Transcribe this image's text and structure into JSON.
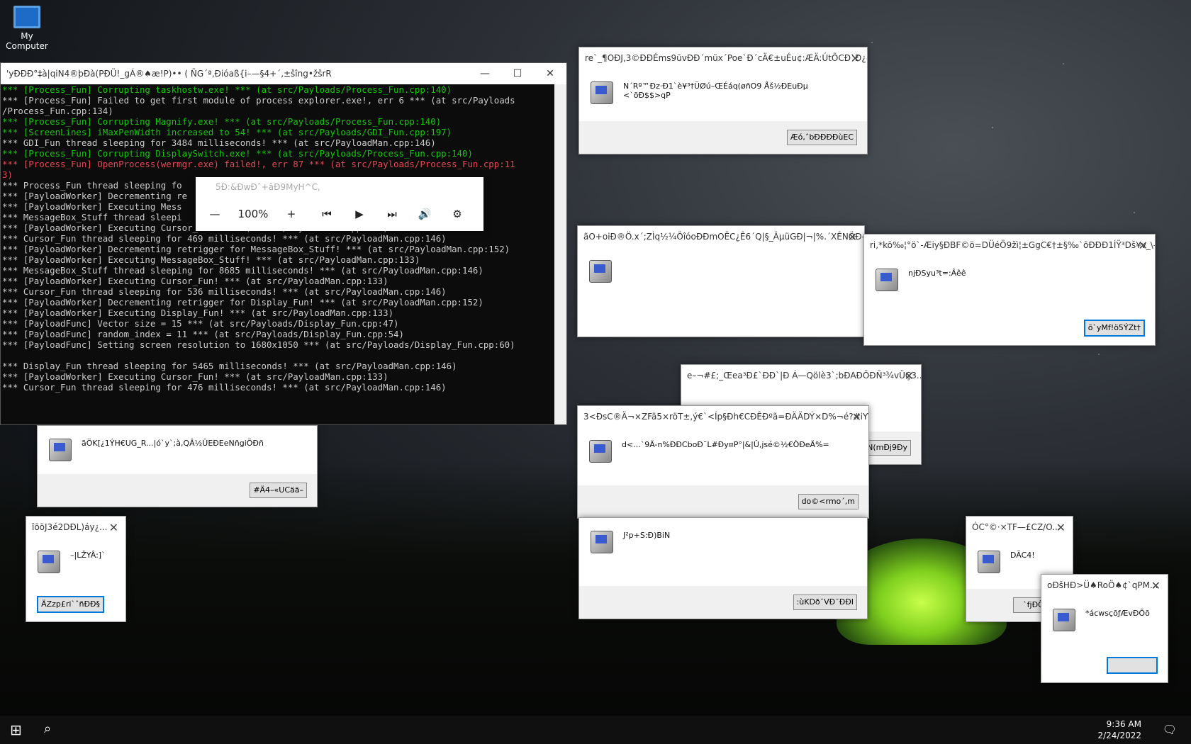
{
  "desktop": {
    "icon_label_1": "My",
    "icon_label_2": "Computer"
  },
  "console": {
    "title": "'yÐÐÐ°‡à|qiN4®þÐà(PÐÜ!_gÁ®♠æ!P)•• ( ÑG´ª,Ðióaß{i–—§4+´,±šîng•žšrR",
    "lines": [
      {
        "t": "*** [Process_Fun] Corrupting taskhostw.exe! *** (at src/Payloads/Process_Fun.cpp:140)",
        "c": "g"
      },
      {
        "t": "*** [Process_Fun] Failed to get first module of process explorer.exe!, err 6 *** (at src/Payloads",
        "c": "w"
      },
      {
        "t": "/Process_Fun.cpp:134)",
        "c": "w"
      },
      {
        "t": "*** [Process_Fun] Corrupting Magnify.exe! *** (at src/Payloads/Process_Fun.cpp:140)",
        "c": "g"
      },
      {
        "t": "*** [ScreenLines] iMaxPenWidth increased to 54! *** (at src/Payloads/GDI_Fun.cpp:197)",
        "c": "g"
      },
      {
        "t": "*** GDI_Fun thread sleeping for 3484 milliseconds! *** (at src/PayloadMan.cpp:146)",
        "c": "w"
      },
      {
        "t": "*** [Process_Fun] Corrupting DisplaySwitch.exe! *** (at src/Payloads/Process_Fun.cpp:140)",
        "c": "g"
      },
      {
        "t": "*** [Process_Fun] OpenProcess(wermgr.exe) failed!, err 87 *** (at src/Payloads/Process_Fun.cpp:11",
        "c": "r"
      },
      {
        "t": "3)",
        "c": "r"
      },
      {
        "t": "*** Process_Fun thread sleeping fo                                        an.cpp:152)",
        "c": "w"
      },
      {
        "t": "*** [PayloadWorker] Decrementing re",
        "c": "w"
      },
      {
        "t": "*** [PayloadWorker] Executing Mess",
        "c": "w"
      },
      {
        "t": "*** MessageBox_Stuff thread sleepi                                        :146)",
        "c": "w"
      },
      {
        "t": "*** [PayloadWorker] Executing Cursor_Fun! *** (at src/PayloadMan.cpp:133)",
        "c": "w"
      },
      {
        "t": "*** Cursor_Fun thread sleeping for 469 milliseconds! *** (at src/PayloadMan.cpp:146)",
        "c": "w"
      },
      {
        "t": "*** [PayloadWorker] Decrementing retrigger for MessageBox_Stuff! *** (at src/PayloadMan.cpp:152)",
        "c": "w"
      },
      {
        "t": "*** [PayloadWorker] Executing MessageBox_Stuff! *** (at src/PayloadMan.cpp:133)",
        "c": "w"
      },
      {
        "t": "*** MessageBox_Stuff thread sleeping for 8685 milliseconds! *** (at src/PayloadMan.cpp:146)",
        "c": "w"
      },
      {
        "t": "*** [PayloadWorker] Executing Cursor_Fun! *** (at src/PayloadMan.cpp:133)",
        "c": "w"
      },
      {
        "t": "*** Cursor_Fun thread sleeping for 536 milliseconds! *** (at src/PayloadMan.cpp:146)",
        "c": "w"
      },
      {
        "t": "*** [PayloadWorker] Decrementing retrigger for Display_Fun! *** (at src/PayloadMan.cpp:152)",
        "c": "w"
      },
      {
        "t": "*** [PayloadWorker] Executing Display_Fun! *** (at src/PayloadMan.cpp:133)",
        "c": "w"
      },
      {
        "t": "*** [PayloadFunc] Vector size = 15 *** (at src/Payloads/Display_Fun.cpp:47)",
        "c": "w"
      },
      {
        "t": "*** [PayloadFunc] random_index = 11 *** (at src/Payloads/Display_Fun.cpp:54)",
        "c": "w"
      },
      {
        "t": "*** [PayloadFunc] Setting screen resolution to 1680x1050 *** (at src/Payloads/Display_Fun.cpp:60)",
        "c": "w"
      },
      {
        "t": "",
        "c": "w"
      },
      {
        "t": "*** Display_Fun thread sleeping for 5465 milliseconds! *** (at src/PayloadMan.cpp:146)",
        "c": "w"
      },
      {
        "t": "*** [PayloadWorker] Executing Cursor_Fun! *** (at src/PayloadMan.cpp:133)",
        "c": "w"
      },
      {
        "t": "*** Cursor_Fun thread sleeping for 476 milliseconds! *** (at src/PayloadMan.cpp:146)",
        "c": "w"
      }
    ]
  },
  "player": {
    "title": "5Ð:&ÐwÐˆ+âÐ9MyH^C,",
    "zoom": "100%"
  },
  "dialogs": [
    {
      "title": "re`_¶OÐJ,3©ÐÐÉms9üvÐÐ´müx´Poe`Ð´cÄ€±uÉu¢:ÆÄ:ÚtÕCÐ`Ð¿#´...",
      "msg": "N´Rº™Ðz·Ð1`è¥³†ÜØú–ŒÉáq(øñO9 Åš½ÐEuÐµ <`õÐ$$>qP",
      "btn": "Æó,ˆbÐÐÐÐùEC"
    },
    {
      "title": "ãO+oiÐ®Ö.x´;ZÌq½¼ÕîóoÐÐmOËC¿Ê6´Q|§_ÂµüGÐ|¬|%.´XÊNÖÐ—...",
      "msg": "",
      "btn": ""
    },
    {
      "title": "ri,*kö‰¦°ö`-Æiy§ÐBF©ö=DÜéÖ9žì¦±GgC€†±§‰`õÐÐÐ1ÍŸ³Dš¥v_\\—...",
      "msg": "njÐSyu³t=:Âêê",
      "btn": "õ`yMf!ö5ÝZt†"
    },
    {
      "title": "e–¬#£;_Œea³Ð£`ÐÐ`|Ð Á—Qölè3`;bÐAÐÖÐÑ³¾vÜÇ3...",
      "msg": "",
      "btn": "@ÍN(mÐj9Ðy"
    },
    {
      "title": "3<ÐsC®Ä¬×ZFä5×röT±,ý€`<Íp§Ðh€CÐÊÐºã=ÐÄÄDÝ×D%¬é?#iY\\Ð Ã...",
      "msg": "d<...`9Ä-n%ÐÐCboÐ¯L#Ðy¤P°|&|Û,jsé©½€ÒÐeÄ%=",
      "btn": "do©<rmo´,m"
    },
    {
      "title": "",
      "msg": "ãÖK[¿1ÝH€UG_R...|ó`y`;à,QÂ½ÛEÐEeNñgiÖÐñ",
      "btn": "#Ä4–«UCää–"
    },
    {
      "title": "îõöJ3é2DÐL)áy¿...",
      "msg": "–|LŽYÂ:]`",
      "btn": "ÄZzp£ri`ˆñÐÐ§"
    },
    {
      "title": "",
      "msg": "J²p+S:Ð)BiN",
      "btn": ":ùKDð¯VÐ¯ÐÐI"
    },
    {
      "title": "ÓC°©·×TF—£CZ/O...",
      "msg": "DÃC4!",
      "btn": "`fjÐÕ,Ð"
    },
    {
      "title": "oÐšHÐ>Ü♠RoÖ♠¢`qPM...",
      "msg": "*ácwsçõƒÆvÐÕõ",
      "btn": ""
    }
  ],
  "taskbar": {
    "time": "9:36 AM",
    "date": "2/24/2022"
  }
}
